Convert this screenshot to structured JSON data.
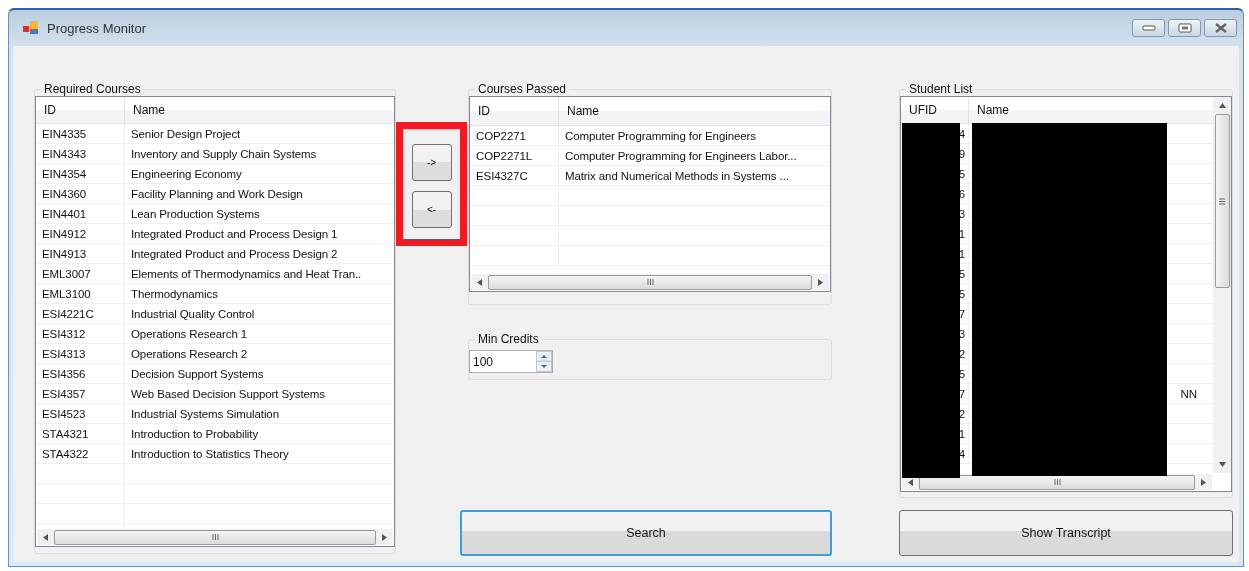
{
  "window": {
    "title": "Progress Monitor"
  },
  "required_courses": {
    "title": "Required Courses",
    "columns": [
      "ID",
      "Name"
    ],
    "rows": [
      {
        "id": "EIN4335",
        "name": "Senior Design Project"
      },
      {
        "id": "EIN4343",
        "name": "Inventory and Supply Chain Systems"
      },
      {
        "id": "EIN4354",
        "name": "Engineering Economy"
      },
      {
        "id": "EIN4360",
        "name": "Facility Planning and Work Design"
      },
      {
        "id": "EIN4401",
        "name": "Lean Production Systems"
      },
      {
        "id": "EIN4912",
        "name": "Integrated Product and Process Design 1"
      },
      {
        "id": "EIN4913",
        "name": "Integrated Product and Process Design 2"
      },
      {
        "id": "EML3007",
        "name": "Elements of Thermodynamics and Heat Tran.."
      },
      {
        "id": "EML3100",
        "name": "Thermodynamics"
      },
      {
        "id": "ESI4221C",
        "name": "Industrial Quality Control"
      },
      {
        "id": "ESI4312",
        "name": "Operations Research 1"
      },
      {
        "id": "ESI4313",
        "name": "Operations Research 2"
      },
      {
        "id": "ESI4356",
        "name": "Decision Support Systems"
      },
      {
        "id": "ESI4357",
        "name": "Web Based Decision Support Systems"
      },
      {
        "id": "ESI4523",
        "name": "Industrial Systems Simulation"
      },
      {
        "id": "STA4321",
        "name": "Introduction to Probability"
      },
      {
        "id": "STA4322",
        "name": "Introduction to Statistics Theory"
      }
    ]
  },
  "move_buttons": {
    "highlighted": true,
    "labels": [
      "->",
      "<-"
    ]
  },
  "courses_passed": {
    "title": "Courses Passed",
    "columns": [
      "ID",
      "Name"
    ],
    "rows": [
      {
        "id": "COP2271",
        "name": "Computer Programming for Engineers"
      },
      {
        "id": "COP2271L",
        "name": "Computer Programming for Engineers Labor..."
      },
      {
        "id": "ESI4327C",
        "name": "Matrix and Numerical Methods in Systems ..."
      }
    ]
  },
  "min_credits": {
    "title": "Min Credits",
    "value": "100"
  },
  "search_button": {
    "label": "Search",
    "focused": true
  },
  "student_list": {
    "title": "Student List",
    "redacted": true,
    "columns": [
      "UFID",
      "Name"
    ],
    "rows": [
      {
        "ufid": "4"
      },
      {
        "ufid": "9"
      },
      {
        "ufid": "5"
      },
      {
        "ufid": "6"
      },
      {
        "ufid": "3"
      },
      {
        "ufid": "1"
      },
      {
        "ufid": "1"
      },
      {
        "ufid": "5"
      },
      {
        "ufid": "5"
      },
      {
        "ufid": "7"
      },
      {
        "ufid": "3"
      },
      {
        "ufid": "2"
      },
      {
        "ufid": "5"
      },
      {
        "ufid": "7",
        "name": "NN"
      },
      {
        "ufid": "2"
      },
      {
        "ufid": "1"
      },
      {
        "ufid": "4"
      }
    ]
  },
  "transcript_button": {
    "label": "Show Transcript"
  }
}
